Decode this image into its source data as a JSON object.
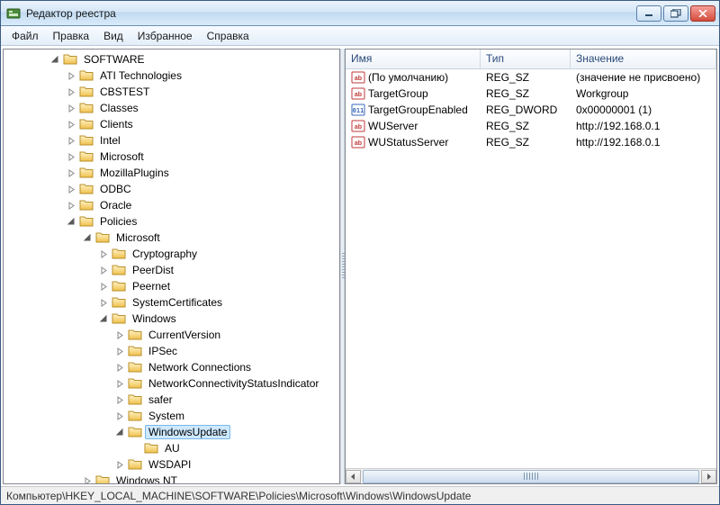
{
  "window": {
    "title": "Редактор реестра"
  },
  "menu": {
    "file": "Файл",
    "edit": "Правка",
    "view": "Вид",
    "favorites": "Избранное",
    "help": "Справка"
  },
  "tree": {
    "software": "SOFTWARE",
    "ati": "ATI Technologies",
    "cbstest": "CBSTEST",
    "classes": "Classes",
    "clients": "Clients",
    "intel": "Intel",
    "microsoft": "Microsoft",
    "mozilla": "MozillaPlugins",
    "odbc": "ODBC",
    "oracle": "Oracle",
    "policies": "Policies",
    "pol_microsoft": "Microsoft",
    "cryptography": "Cryptography",
    "peerdist": "PeerDist",
    "peernet": "Peernet",
    "syscerts": "SystemCertificates",
    "windows": "Windows",
    "currentversion": "CurrentVersion",
    "ipsec": "IPSec",
    "netconn": "Network Connections",
    "ncsi": "NetworkConnectivityStatusIndicator",
    "safer": "safer",
    "system": "System",
    "windowsupdate": "WindowsUpdate",
    "au": "AU",
    "wsdapi": "WSDAPI",
    "windowsnt": "Windows NT"
  },
  "columns": {
    "name": "Имя",
    "type": "Тип",
    "value": "Значение"
  },
  "values": [
    {
      "icon": "sz",
      "name": "(По умолчанию)",
      "type": "REG_SZ",
      "data": "(значение не присвоено)"
    },
    {
      "icon": "sz",
      "name": "TargetGroup",
      "type": "REG_SZ",
      "data": "Workgroup"
    },
    {
      "icon": "dw",
      "name": "TargetGroupEnabled",
      "type": "REG_DWORD",
      "data": "0x00000001 (1)"
    },
    {
      "icon": "sz",
      "name": "WUServer",
      "type": "REG_SZ",
      "data": "http://192.168.0.1"
    },
    {
      "icon": "sz",
      "name": "WUStatusServer",
      "type": "REG_SZ",
      "data": "http://192.168.0.1"
    }
  ],
  "statusbar": {
    "path": "Компьютер\\HKEY_LOCAL_MACHINE\\SOFTWARE\\Policies\\Microsoft\\Windows\\WindowsUpdate"
  }
}
